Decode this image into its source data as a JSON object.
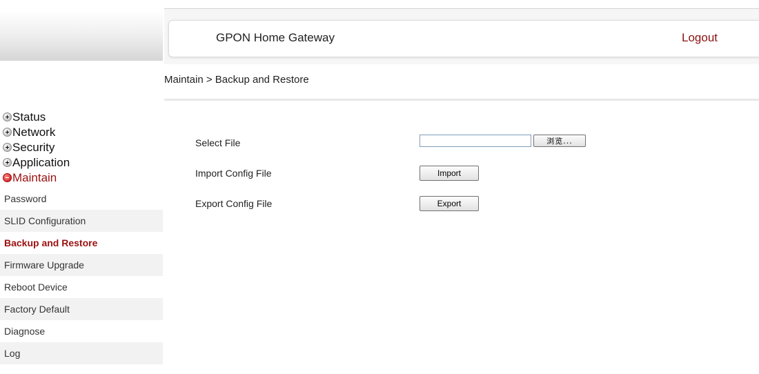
{
  "header": {
    "title": "GPON Home Gateway",
    "logout_label": "Logout"
  },
  "breadcrumb": "Maintain > Backup and Restore",
  "sidebar": {
    "menus": [
      {
        "label": "Status",
        "state": "collapsed"
      },
      {
        "label": "Network",
        "state": "collapsed"
      },
      {
        "label": "Security",
        "state": "collapsed"
      },
      {
        "label": "Application",
        "state": "collapsed"
      },
      {
        "label": "Maintain",
        "state": "expanded"
      }
    ],
    "submenu": [
      {
        "label": "Password"
      },
      {
        "label": "SLID Configuration"
      },
      {
        "label": "Backup and Restore",
        "active": true
      },
      {
        "label": "Firmware Upgrade"
      },
      {
        "label": "Reboot Device"
      },
      {
        "label": "Factory Default"
      },
      {
        "label": "Diagnose"
      },
      {
        "label": "Log"
      }
    ]
  },
  "form": {
    "select_file_label": "Select File",
    "file_value": "",
    "browse_label": "浏览...",
    "import_label": "Import Config File",
    "import_button": "Import",
    "export_label": "Export Config File",
    "export_button": "Export"
  },
  "colors": {
    "accent": "#9b1010",
    "logout": "#8b1010"
  }
}
